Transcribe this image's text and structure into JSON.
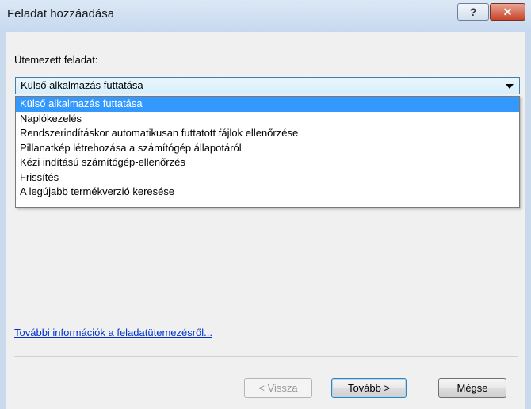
{
  "window": {
    "title": "Feladat hozzáadása"
  },
  "titlebar": {
    "help_label": "?",
    "close_label": "✕"
  },
  "form": {
    "label": "Ütemezett feladat:",
    "combo_value": "Külső alkalmazás futtatása",
    "options": [
      "Külső alkalmazás futtatása",
      "Naplókezelés",
      "Rendszerindításkor automatikusan futtatott fájlok ellenőrzése",
      "Pillanatkép létrehozása a számítógép állapotáról",
      "Kézi indítású számítógép-ellenőrzés",
      "Frissítés",
      "A legújabb termékverzió keresése"
    ],
    "selected_index": 0
  },
  "link_text": "További információk a feladatütemezésről...",
  "buttons": {
    "back": "< Vissza",
    "next": "Tovább >",
    "cancel": "Mégse"
  },
  "colors": {
    "selection": "#3399ff",
    "link": "#0033cc",
    "dialog_bg": "#f0f0f0"
  },
  "icons": {
    "dropdown_arrow": "chevron-down-icon"
  }
}
